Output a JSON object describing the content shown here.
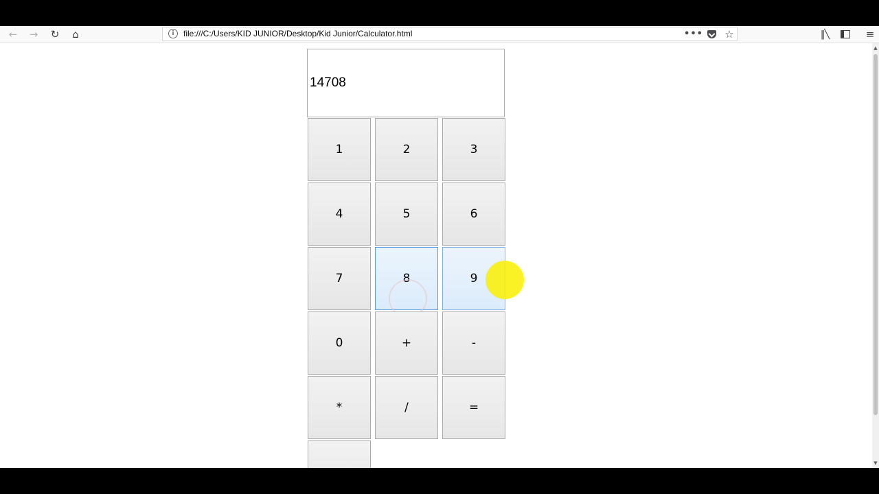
{
  "browser": {
    "url": "file:///C:/Users/KID JUNIOR/Desktop/Kid Junior/Calculator.html",
    "icons": {
      "back": "back-arrow-icon",
      "forward": "forward-arrow-icon",
      "reload": "reload-icon",
      "home": "home-icon",
      "info": "info-icon",
      "page_actions": "more-dots-icon",
      "pocket": "pocket-icon",
      "bookmark": "star-icon",
      "library": "library-icon",
      "sidebar": "sidebar-icon",
      "menu": "hamburger-menu-icon"
    }
  },
  "calculator": {
    "display_value": "14708",
    "keys": {
      "k1": "1",
      "k2": "2",
      "k3": "3",
      "k4": "4",
      "k5": "5",
      "k6": "6",
      "k7": "7",
      "k8": "8",
      "k9": "9",
      "k0": "0",
      "plus": "+",
      "minus": "-",
      "multiply": "*",
      "divide": "/",
      "equals": "=",
      "partial": ""
    },
    "pressed_key": "8",
    "hovered_key": "9"
  },
  "colors": {
    "pressed_border": "#569de5",
    "cursor_highlight": "#faf000"
  }
}
